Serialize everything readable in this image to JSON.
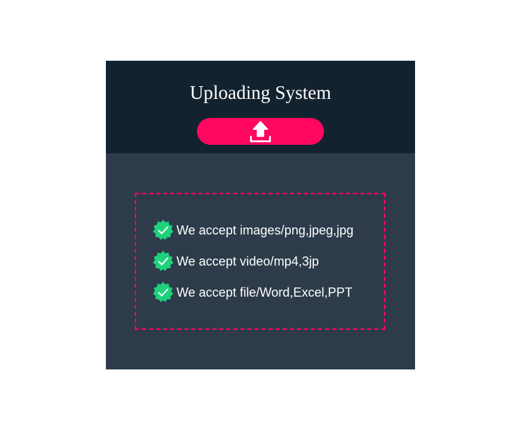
{
  "header": {
    "title": "Uploading System",
    "upload_button_icon": "upload-icon"
  },
  "drop_zone": {
    "items": [
      {
        "icon": "verified-check-icon",
        "text": "We accept images/png,jpeg,jpg"
      },
      {
        "icon": "verified-check-icon",
        "text": "We accept video/mp4,3jp"
      },
      {
        "icon": "verified-check-icon",
        "text": "We accept file/Word,Excel,PPT"
      }
    ]
  },
  "colors": {
    "header_bg": "#13222f",
    "body_bg": "#2d3b4a",
    "accent": "#ff0761",
    "check_badge": "#1fd07c"
  }
}
